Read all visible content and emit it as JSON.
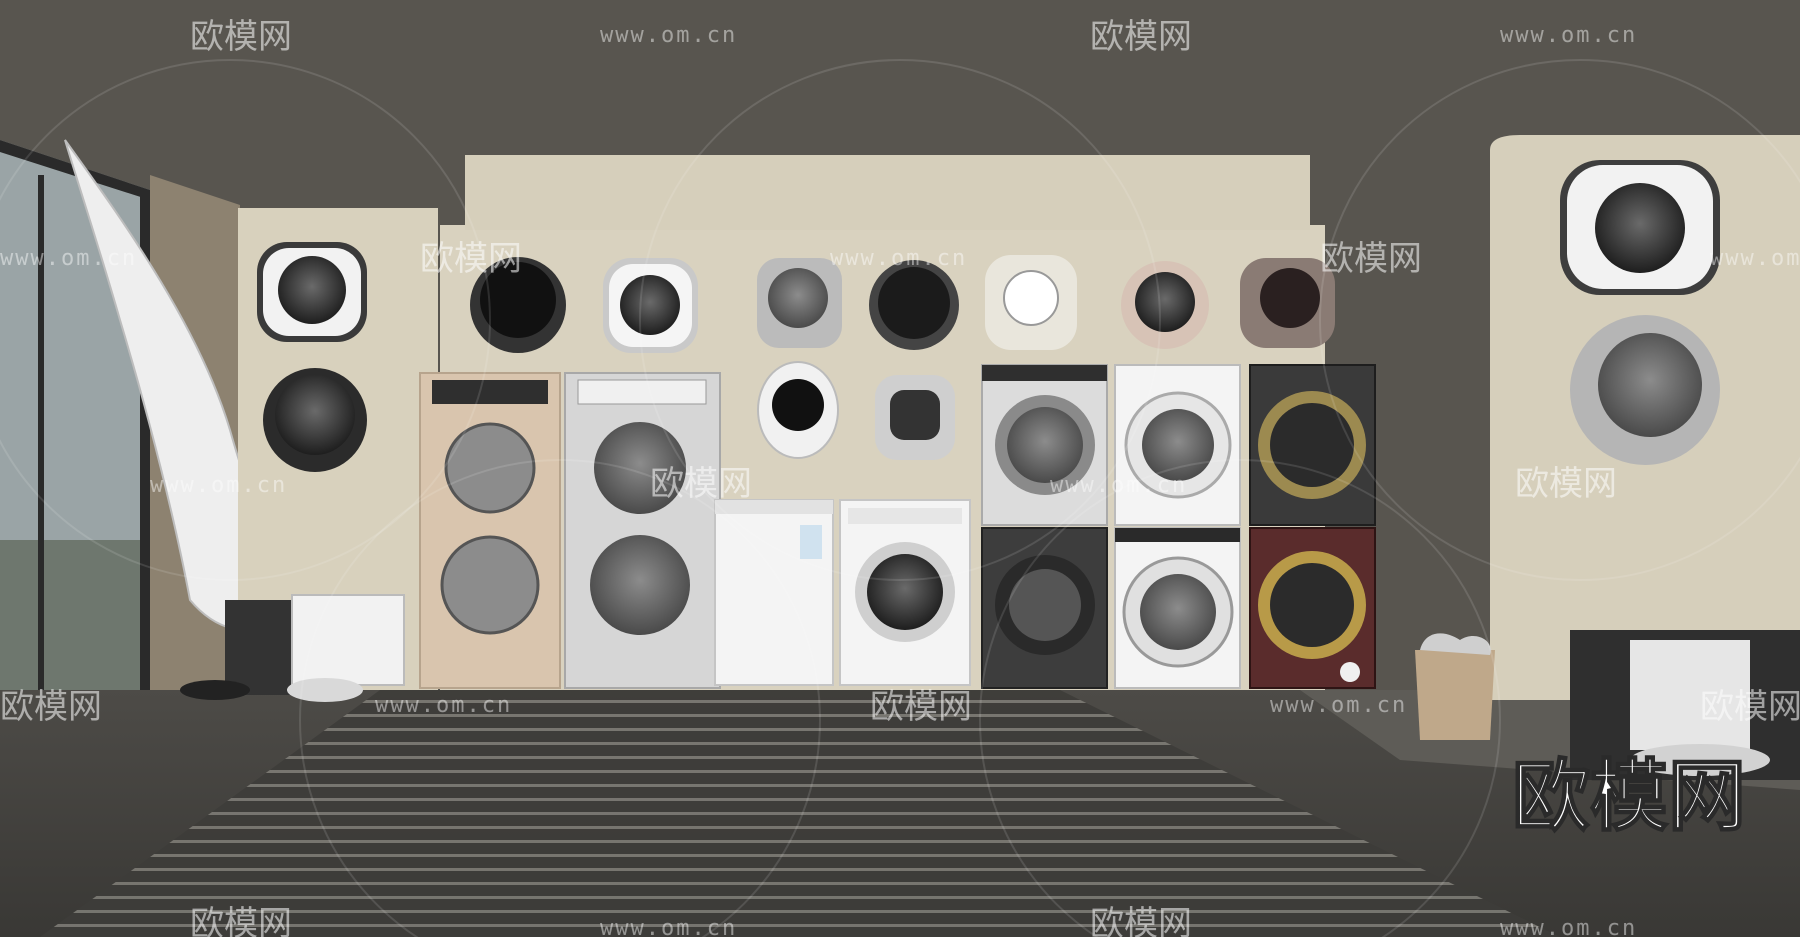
{
  "scene": {
    "description_type": "3D render",
    "brand_watermark": "欧模网",
    "url_watermark": "www.om.cn",
    "corner_logo": "欧模网"
  },
  "colors": {
    "wall_dark": "#57544e",
    "wall_cream": "#d9d2bf",
    "floor": "#3f3e3b",
    "stripe": "#8a8880"
  }
}
